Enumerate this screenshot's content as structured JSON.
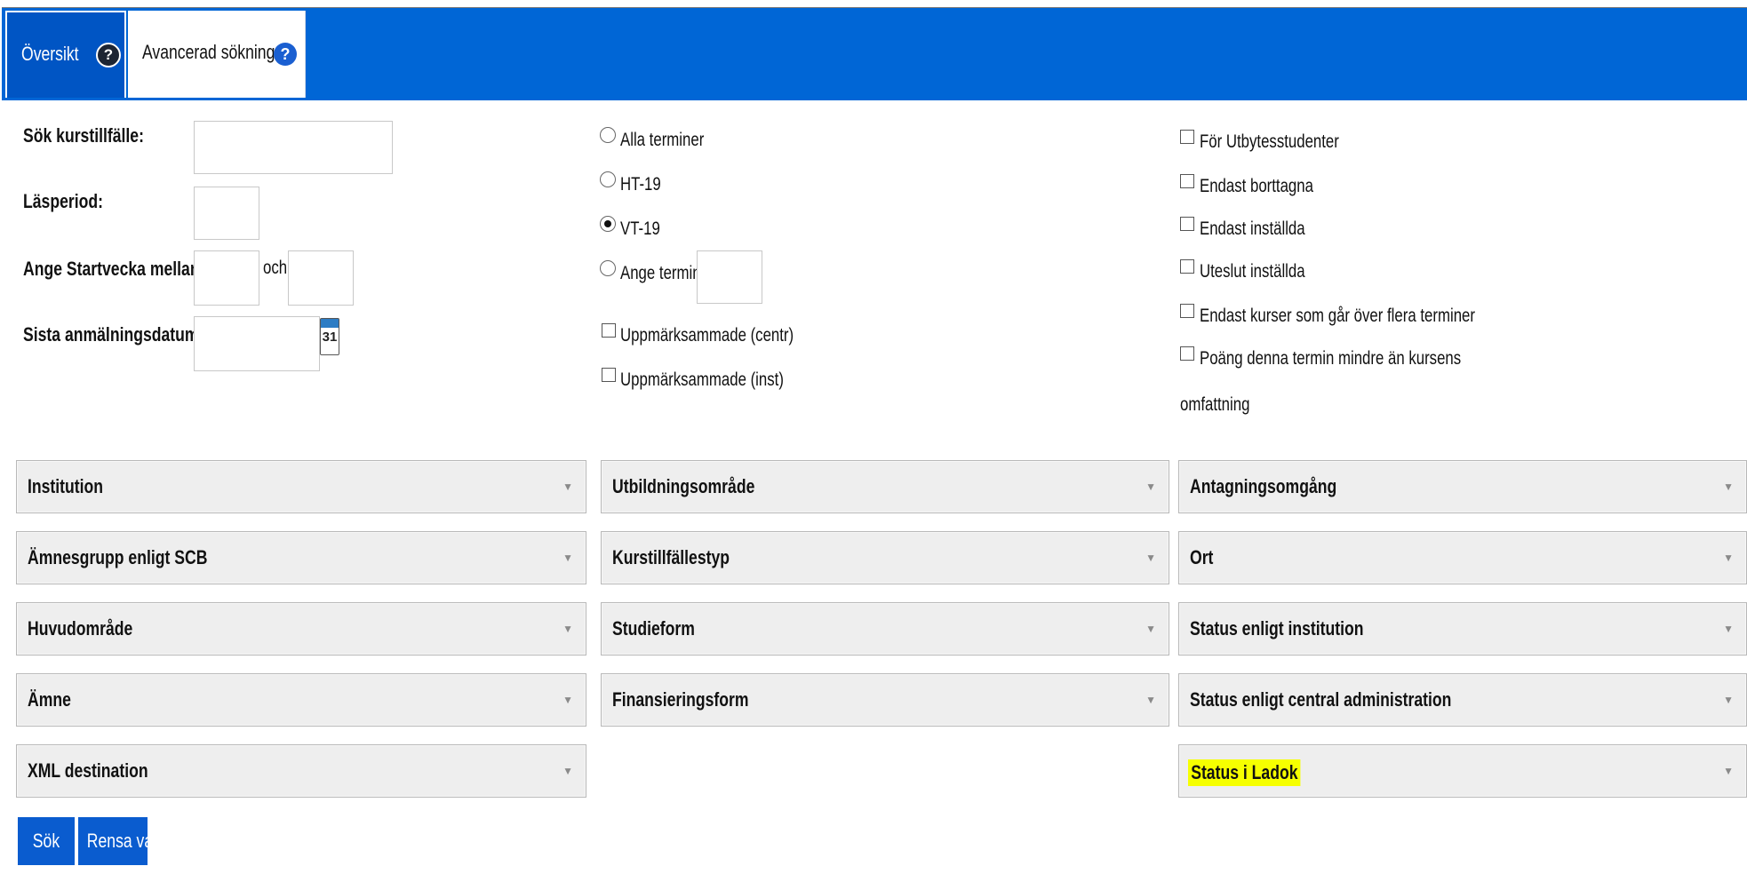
{
  "tabs": {
    "oversikt": "Översikt",
    "avancerad": "Avancerad sökning",
    "help_glyph": "?"
  },
  "form": {
    "sok_kurstillfalle_label": "Sök kurstillfälle:",
    "lasperiod_label": "Läsperiod:",
    "startvecka_label": "Ange Startvecka mellan:",
    "och": "och",
    "sista_anmalningsdatum_label": "Sista anmälningsdatum:",
    "calendar_day": "31"
  },
  "terms": {
    "options": [
      "Alla terminer",
      "HT-19",
      "VT-19",
      "Ange termin:"
    ],
    "selected": "VT-19"
  },
  "marked": [
    "Uppmärksammade (centr)",
    "Uppmärksammade (inst)"
  ],
  "filters": [
    "För Utbytesstudenter",
    "Endast borttagna",
    "Endast inställda",
    "Uteslut inställda",
    "Endast kurser som går över flera terminer",
    "Poäng denna termin mindre än kursens"
  ],
  "filters_wrap": "omfattning",
  "dropdowns": {
    "col1": [
      "Institution",
      "Ämnesgrupp enligt SCB",
      "Huvudområde",
      "Ämne",
      "XML destination"
    ],
    "col2": [
      "Utbildningsområde",
      "Kurstillfällestyp",
      "Studieform",
      "Finansieringsform"
    ],
    "col3": [
      "Antagningsomgång",
      "Ort",
      "Status enligt institution",
      "Status enligt central administration",
      "Status i Ladok"
    ],
    "arrow_glyph": "▼"
  },
  "buttons": {
    "search": "Sök",
    "clear": "Rensa val"
  },
  "colors": {
    "header_blue": "#0066d6",
    "button_blue": "#0a5ccf",
    "highlight": "#f6ff00"
  }
}
